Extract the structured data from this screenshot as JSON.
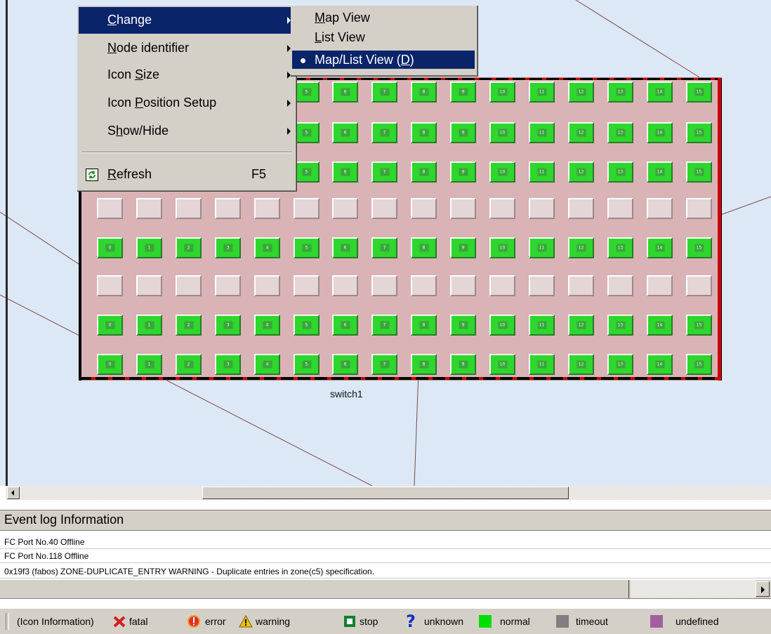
{
  "context_menu": {
    "items": [
      {
        "label": "Change",
        "mnemonic": "C",
        "has_submenu": true,
        "selected": true
      },
      {
        "label": "Node identifier",
        "mnemonic": "N",
        "has_submenu": true
      },
      {
        "label": "Icon Size",
        "mnemonic": "S",
        "has_submenu": true
      },
      {
        "label": "Icon Position Setup",
        "mnemonic": "P",
        "has_submenu": true
      },
      {
        "label": "Show/Hide",
        "mnemonic": "h",
        "has_submenu": true
      },
      {
        "label": "Refresh",
        "mnemonic": "R",
        "shortcut": "F5",
        "icon": "refresh-icon"
      }
    ]
  },
  "submenu": {
    "items": [
      {
        "label": "Map View"
      },
      {
        "label": "List View"
      },
      {
        "label": "Map/List View (D)",
        "selected": true,
        "checked": true
      }
    ]
  },
  "switch": {
    "label": "switch1",
    "port_numbers": [
      "0",
      "1",
      "2",
      "3",
      "4",
      "5",
      "6",
      "7",
      "8",
      "9",
      "10",
      "11",
      "12",
      "13",
      "14",
      "15"
    ],
    "rows": [
      {
        "type": "normal",
        "first_visible_port": 5
      },
      {
        "type": "normal",
        "first_visible_port": 5
      },
      {
        "type": "normal",
        "first_visible_port": 5
      },
      {
        "type": "empty"
      },
      {
        "type": "normal"
      },
      {
        "type": "empty"
      },
      {
        "type": "normal"
      },
      {
        "type": "normal"
      }
    ]
  },
  "event_log": {
    "title": "Event log Information",
    "rows": [
      "FC Port No.40 Offline",
      "FC Port No.118 Offline",
      "0x19f3 (fabos) ZONE-DUPLICATE_ENTRY WARNING - Duplicate entries in zone(c5) specification."
    ]
  },
  "legend": {
    "title": "(Icon Information)",
    "items": [
      {
        "label": "fatal",
        "icon": "fatal-icon",
        "color": "#d02020"
      },
      {
        "label": "error",
        "icon": "error-icon",
        "color": "#e03030"
      },
      {
        "label": "warning",
        "icon": "warning-icon",
        "color": "#f2c400"
      },
      {
        "label": "stop",
        "icon": "stop-icon",
        "color": "#108030"
      },
      {
        "label": "unknown",
        "icon": "unknown-icon",
        "color": "#1030c0"
      },
      {
        "label": "normal",
        "icon": "normal-swatch",
        "color": "#00e000"
      },
      {
        "label": "timeout",
        "icon": "timeout-swatch",
        "color": "#808080"
      },
      {
        "label": "undefined",
        "icon": "undefined-swatch",
        "color": "#a060a0"
      }
    ]
  },
  "colors": {
    "map_background": "#dce8f6",
    "switch_background": "#d9b3b6",
    "port_normal": "#2ed62e",
    "menu_highlight": "#0a246a",
    "link_line": "#7a4a4a"
  }
}
